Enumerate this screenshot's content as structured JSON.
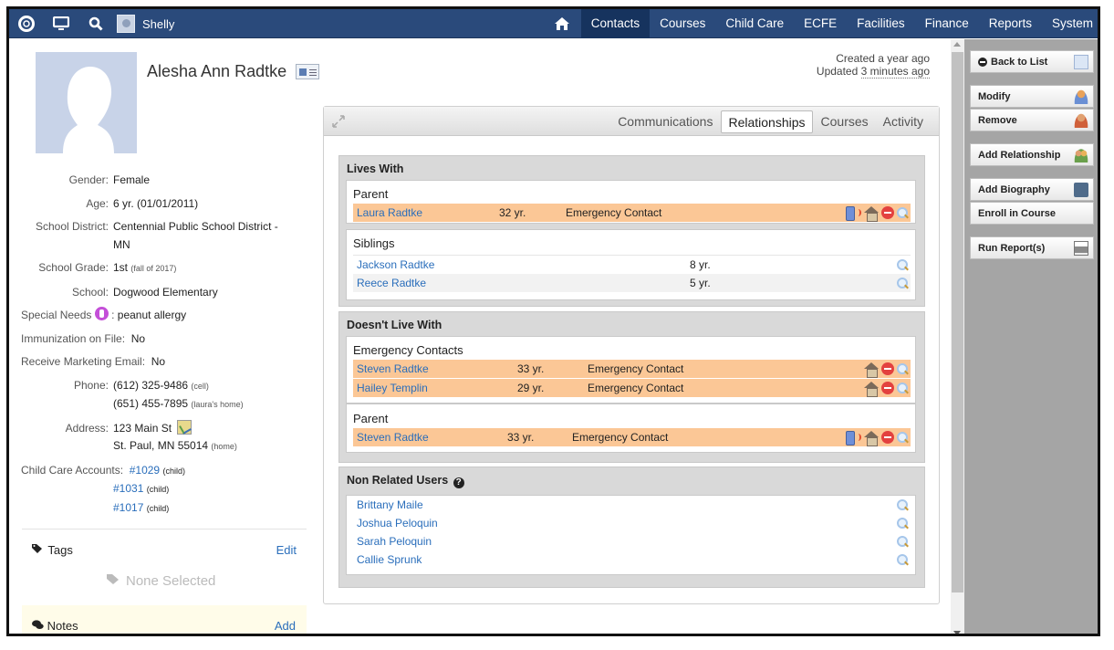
{
  "topnav": {
    "user_name": "Shelly",
    "items": [
      "Contacts",
      "Courses",
      "Child Care",
      "ECFE",
      "Facilities",
      "Finance",
      "Reports",
      "System"
    ],
    "active": "Contacts"
  },
  "person": {
    "name": "Alesha Ann Radtke",
    "created": "Created a year ago",
    "updated_prefix": "Updated ",
    "updated_value": "3 minutes ago"
  },
  "info": {
    "gender_label": "Gender:",
    "gender": "Female",
    "age_label": "Age:",
    "age": "6 yr. (01/01/2011)",
    "district_label": "School District:",
    "district": "Centennial Public School District - MN",
    "grade_label": "School Grade:",
    "grade": "1st",
    "grade_note": "(fall of 2017)",
    "school_label": "School:",
    "school": "Dogwood Elementary",
    "special_label": "Special Needs",
    "special_sep": ":",
    "special": "peanut allergy",
    "immun_label": "Immunization on File:",
    "immun": "No",
    "marketing_label": "Receive Marketing Email:",
    "marketing": "No",
    "phone_label": "Phone:",
    "phone1": "(612) 325-9486",
    "phone1_note": "(cell)",
    "phone2": "(651) 455-7895",
    "phone2_note": "(laura's home)",
    "address_label": "Address:",
    "address1": "123 Main St",
    "address2": "St. Paul, MN 55014",
    "address_note": "(home)",
    "cc_label": "Child Care Accounts:",
    "cc": [
      {
        "num": "#1029",
        "note": "(child)"
      },
      {
        "num": "#1031",
        "note": "(child)"
      },
      {
        "num": "#1017",
        "note": "(child)"
      }
    ]
  },
  "tags": {
    "label": "Tags",
    "edit": "Edit",
    "none": "None Selected"
  },
  "notes": {
    "label": "Notes",
    "add": "Add"
  },
  "tabs": [
    "Communications",
    "Relationships",
    "Courses",
    "Activity"
  ],
  "active_tab": "Relationships",
  "lives_with": {
    "title": "Lives With",
    "parent_label": "Parent",
    "parent": {
      "name": "Laura Radtke",
      "age": "32 yr.",
      "role": "Emergency Contact"
    },
    "siblings_label": "Siblings",
    "siblings": [
      {
        "name": "Jackson Radtke",
        "age": "8 yr."
      },
      {
        "name": "Reece Radtke",
        "age": "5 yr."
      }
    ]
  },
  "doesnt_live": {
    "title": "Doesn't Live With",
    "ec_label": "Emergency Contacts",
    "ec": [
      {
        "name": "Steven Radtke",
        "age": "33 yr.",
        "role": "Emergency Contact"
      },
      {
        "name": "Hailey Templin",
        "age": "29 yr.",
        "role": "Emergency Contact"
      }
    ],
    "parent_label": "Parent",
    "parent": {
      "name": "Steven Radtke",
      "age": "33 yr.",
      "role": "Emergency Contact"
    }
  },
  "non_related": {
    "title": "Non Related Users",
    "users": [
      "Brittany Maile",
      "Joshua Peloquin",
      "Sarah Peloquin",
      "Callie Sprunk"
    ]
  },
  "sidebar": {
    "back": "Back to List",
    "modify": "Modify",
    "remove": "Remove",
    "add_rel": "Add Relationship",
    "add_bio": "Add Biography",
    "enroll": "Enroll in Course",
    "report": "Run Report(s)"
  },
  "colors": {
    "nav": "#2a4a7b",
    "nav_active": "#16335e",
    "highlight": "#fbc796",
    "link": "#2a6ebb"
  }
}
